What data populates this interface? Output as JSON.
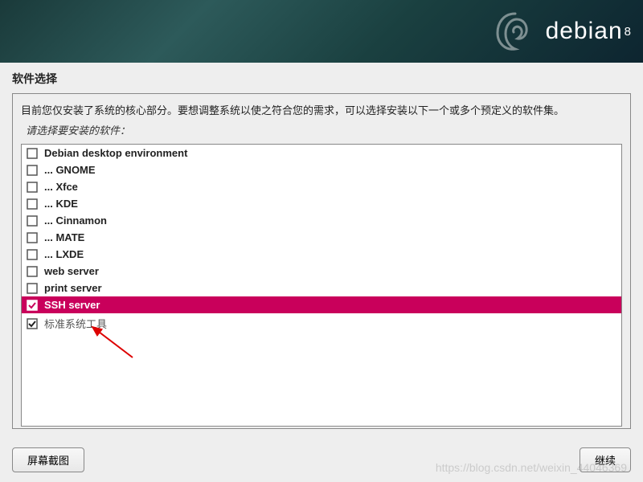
{
  "header": {
    "logo_text": "debian",
    "version": "8"
  },
  "title": "软件选择",
  "description": "目前您仅安装了系统的核心部分。要想调整系统以使之符合您的需求，可以选择安装以下一个或多个预定义的软件集。",
  "prompt": "请选择要安装的软件：",
  "software": [
    {
      "label": "Debian desktop environment",
      "checked": false,
      "selected": false,
      "grey": false
    },
    {
      "label": "... GNOME",
      "checked": false,
      "selected": false,
      "grey": false
    },
    {
      "label": "... Xfce",
      "checked": false,
      "selected": false,
      "grey": false
    },
    {
      "label": "... KDE",
      "checked": false,
      "selected": false,
      "grey": false
    },
    {
      "label": "... Cinnamon",
      "checked": false,
      "selected": false,
      "grey": false
    },
    {
      "label": "... MATE",
      "checked": false,
      "selected": false,
      "grey": false
    },
    {
      "label": "... LXDE",
      "checked": false,
      "selected": false,
      "grey": false
    },
    {
      "label": "web server",
      "checked": false,
      "selected": false,
      "grey": false
    },
    {
      "label": "print server",
      "checked": false,
      "selected": false,
      "grey": false
    },
    {
      "label": "SSH server",
      "checked": true,
      "selected": true,
      "grey": false
    },
    {
      "label": "标准系统工具",
      "checked": true,
      "selected": false,
      "grey": true
    }
  ],
  "buttons": {
    "screenshot": "屏幕截图",
    "continue": "继续"
  },
  "watermark": "https://blog.csdn.net/weixin_44046369"
}
